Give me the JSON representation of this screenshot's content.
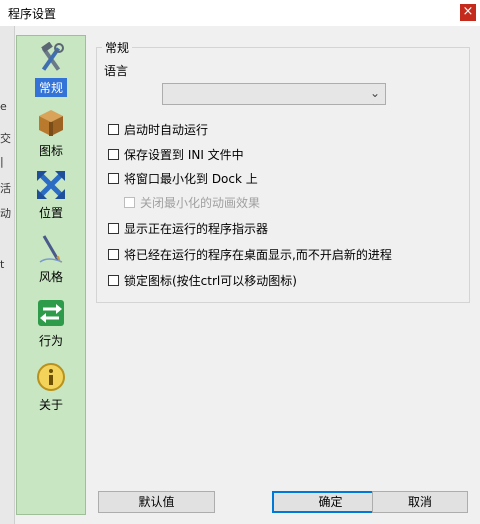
{
  "window": {
    "title": "程序设置",
    "close_glyph": "×"
  },
  "left_edge_glyphs": [
    "e",
    "交",
    "|",
    "活",
    "动",
    "t"
  ],
  "sidebar": {
    "items": [
      {
        "label": "常规",
        "icon": "tools-icon",
        "selected": true
      },
      {
        "label": "图标",
        "icon": "box-icon",
        "selected": false
      },
      {
        "label": "位置",
        "icon": "arrows-icon",
        "selected": false
      },
      {
        "label": "风格",
        "icon": "pen-icon",
        "selected": false
      },
      {
        "label": "行为",
        "icon": "switch-arrows-icon",
        "selected": false
      },
      {
        "label": "关于",
        "icon": "info-icon",
        "selected": false
      }
    ]
  },
  "general": {
    "group_title": "常规",
    "language_label": "语言",
    "language_value": "",
    "options": [
      {
        "label": "启动时自动运行",
        "checked": false,
        "enabled": true
      },
      {
        "label": "保存设置到 INI 文件中",
        "checked": false,
        "enabled": true
      },
      {
        "label": "将窗口最小化到 Dock 上",
        "checked": false,
        "enabled": true
      },
      {
        "label": "关闭最小化的动画效果",
        "checked": false,
        "enabled": false
      },
      {
        "label": "显示正在运行的程序指示器",
        "checked": false,
        "enabled": true
      },
      {
        "label": "将已经在运行的程序在桌面显示,而不开启新的进程",
        "checked": false,
        "enabled": true
      },
      {
        "label": "锁定图标(按住ctrl可以移动图标)",
        "checked": false,
        "enabled": true
      }
    ]
  },
  "buttons": {
    "default": "默认值",
    "ok": "确定",
    "cancel": "取消"
  },
  "colors": {
    "sidebar_bg": "#c8e6c2",
    "selected_bg": "#3372d6",
    "close_bg": "#c42b1c",
    "focus_border": "#0078d7"
  }
}
